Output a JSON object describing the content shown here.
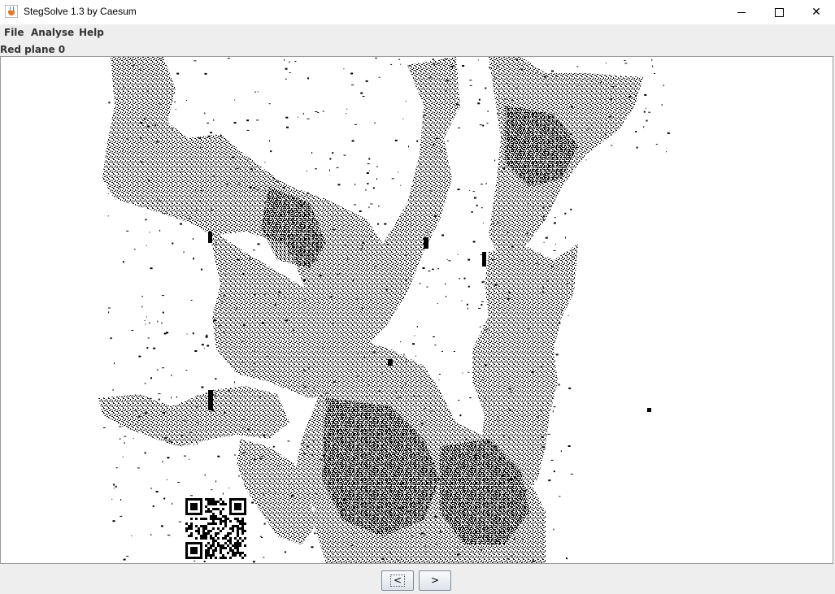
{
  "window": {
    "title": "StegSolve 1.3 by Caesum",
    "controls": {
      "minimize": "minimize",
      "maximize": "maximize",
      "close": "✕"
    }
  },
  "menu": {
    "file": "File",
    "analyse": "Analyse",
    "help": "Help"
  },
  "plane": {
    "label": "Red plane 0"
  },
  "navigation": {
    "prev": "<",
    "next": ">"
  },
  "colors": {
    "image_ink": "#000000",
    "image_background": "#ffffff",
    "window_background": "#eeeeee"
  },
  "icons": [
    "java-coffee-icon",
    "minimize-icon",
    "maximize-icon",
    "close-icon"
  ]
}
